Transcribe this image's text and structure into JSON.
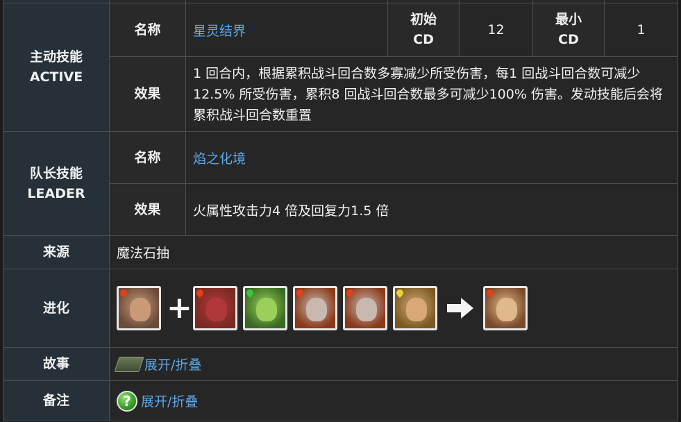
{
  "active": {
    "section_label": "主动技能",
    "section_sub": "ACTIVE",
    "name_label": "名称",
    "name": "星灵结界",
    "cd_start_label_1": "初始",
    "cd_start_label_2": "CD",
    "cd_start": "12",
    "cd_min_label_1": "最小",
    "cd_min_label_2": "CD",
    "cd_min": "1",
    "effect_label": "效果",
    "effect": "1 回合内，根据累积战斗回合数多寡减少所受伤害，每1 回战斗回合数可减少12.5% 所受伤害，累积8 回战斗回合数最多可减少100% 伤害。发动技能后会将累积战斗回合数重置"
  },
  "leader": {
    "section_label": "队长技能",
    "section_sub": "LEADER",
    "name_label": "名称",
    "name": "焰之化境",
    "effect_label": "效果",
    "effect": "火属性攻击力4 倍及回复力1.5 倍"
  },
  "source": {
    "label": "来源",
    "value": "魔法石抽"
  },
  "evolution": {
    "label": "进化",
    "plus": "+",
    "cards": [
      {
        "name": "base-card",
        "attr_color": "#e0401a",
        "bg": "#6b4a3a",
        "face": "#c89a78"
      },
      {
        "name": "material-card-1",
        "attr_color": "#e0401a",
        "bg": "#7a2a22",
        "face": "#b0383a"
      },
      {
        "name": "material-card-2",
        "attr_color": "#3cc43a",
        "bg": "#3a6a22",
        "face": "#9ad05a"
      },
      {
        "name": "material-card-3",
        "attr_color": "#e0401a",
        "bg": "#8a3a1a",
        "face": "#c8b8b0"
      },
      {
        "name": "material-card-4",
        "attr_color": "#e0401a",
        "bg": "#8a3a1a",
        "face": "#c8b8b0"
      },
      {
        "name": "material-card-5",
        "attr_color": "#e8d23a",
        "bg": "#7a5a22",
        "face": "#d8a878"
      },
      {
        "name": "result-card",
        "attr_color": "#e0401a",
        "bg": "#7a4a2a",
        "face": "#e0b88a"
      }
    ]
  },
  "story": {
    "label": "故事",
    "toggle": "展开/折叠"
  },
  "notes": {
    "label": "备注",
    "help_glyph": "?",
    "toggle": "展开/折叠"
  },
  "colors": {
    "link": "#5ea7e8",
    "header_bg": "#253038",
    "cell_bg": "#262626",
    "border": "#4e4e4e"
  }
}
